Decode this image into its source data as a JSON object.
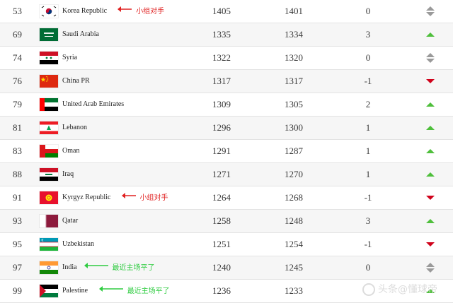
{
  "rows": [
    {
      "rank": "53",
      "team": "Korea Republic",
      "points": "1405",
      "previous": "1401",
      "change": "0",
      "movement": "same",
      "flag": "korea",
      "note": {
        "text": "小组对手",
        "color": "red"
      }
    },
    {
      "rank": "69",
      "team": "Saudi Arabia",
      "points": "1335",
      "previous": "1334",
      "change": "3",
      "movement": "up",
      "flag": "saudi"
    },
    {
      "rank": "74",
      "team": "Syria",
      "points": "1322",
      "previous": "1320",
      "change": "0",
      "movement": "same",
      "flag": "syria"
    },
    {
      "rank": "76",
      "team": "China PR",
      "points": "1317",
      "previous": "1317",
      "change": "-1",
      "movement": "down",
      "flag": "china"
    },
    {
      "rank": "79",
      "team": "United Arab Emirates",
      "points": "1309",
      "previous": "1305",
      "change": "2",
      "movement": "up",
      "flag": "uae"
    },
    {
      "rank": "81",
      "team": "Lebanon",
      "points": "1296",
      "previous": "1300",
      "change": "1",
      "movement": "up",
      "flag": "lebanon"
    },
    {
      "rank": "83",
      "team": "Oman",
      "points": "1291",
      "previous": "1287",
      "change": "1",
      "movement": "up",
      "flag": "oman"
    },
    {
      "rank": "88",
      "team": "Iraq",
      "points": "1271",
      "previous": "1270",
      "change": "1",
      "movement": "up",
      "flag": "iraq"
    },
    {
      "rank": "91",
      "team": "Kyrgyz Republic",
      "points": "1264",
      "previous": "1268",
      "change": "-1",
      "movement": "down",
      "flag": "kyrgyz",
      "note": {
        "text": "小组对手",
        "color": "red"
      }
    },
    {
      "rank": "93",
      "team": "Qatar",
      "points": "1258",
      "previous": "1248",
      "change": "3",
      "movement": "up",
      "flag": "qatar"
    },
    {
      "rank": "95",
      "team": "Uzbekistan",
      "points": "1251",
      "previous": "1254",
      "change": "-1",
      "movement": "down",
      "flag": "uzbekistan"
    },
    {
      "rank": "97",
      "team": "India",
      "points": "1240",
      "previous": "1245",
      "change": "0",
      "movement": "same",
      "flag": "india",
      "note": {
        "text": "最近主场平了",
        "color": "green"
      }
    },
    {
      "rank": "99",
      "team": "Palestine",
      "points": "1236",
      "previous": "1233",
      "change": "",
      "movement": "up",
      "flag": "palestine",
      "note": {
        "text": "最近主场平了",
        "color": "green"
      }
    }
  ],
  "watermark": {
    "text": "头条@懂球帝"
  },
  "colors": {
    "up": "#4fbf3c",
    "down": "#d0021b",
    "same": "#9a9a9a",
    "note_red": "#e02020",
    "note_green": "#2ecc40"
  }
}
